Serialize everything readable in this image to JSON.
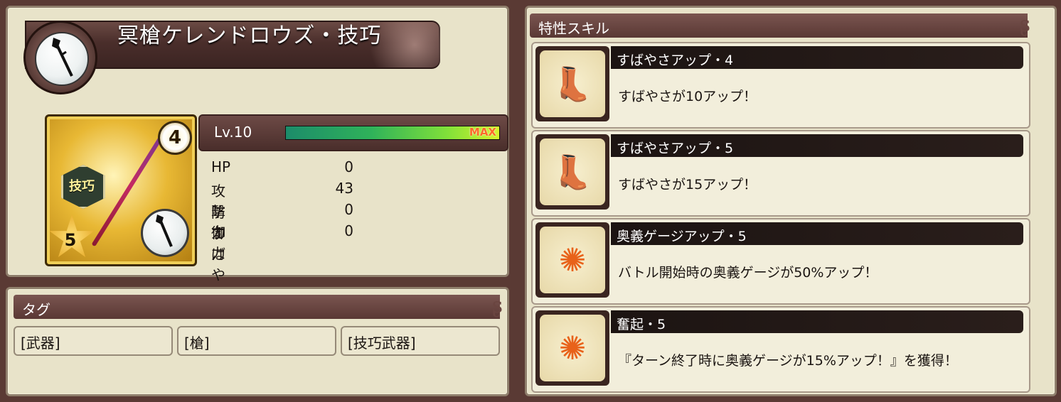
{
  "weapon": {
    "title": "冥槍ケレンドロウズ・技巧",
    "rarity_number": "4",
    "type_badge": "技巧",
    "star_level": "5",
    "level_label": "Lv.10",
    "level_max_label": "MAX",
    "level_progress": 1.0,
    "stats": [
      {
        "label": "HP",
        "value": "0"
      },
      {
        "label": "攻撃力",
        "value": "43"
      },
      {
        "label": "防御力",
        "value": "0"
      },
      {
        "label": "すばやさ",
        "value": "0"
      }
    ]
  },
  "tags": {
    "header": "タグ",
    "items": [
      "[武器]",
      "[槍]",
      "[技巧武器]"
    ]
  },
  "skills": {
    "header": "特性スキル",
    "items": [
      {
        "name": "すばやさアップ・4",
        "description": "すばやさが10アップ！",
        "icon": "boot-icon"
      },
      {
        "name": "すばやさアップ・5",
        "description": "すばやさが15アップ！",
        "icon": "boot-icon"
      },
      {
        "name": "奥義ゲージアップ・5",
        "description": "バトル開始時の奥義ゲージが50%アップ！",
        "icon": "gauge-burst-icon"
      },
      {
        "name": "奮起・5",
        "description": "『ターン終了時に奥義ゲージが15%アップ！』を獲得！",
        "icon": "gauge-burst-icon"
      }
    ]
  }
}
